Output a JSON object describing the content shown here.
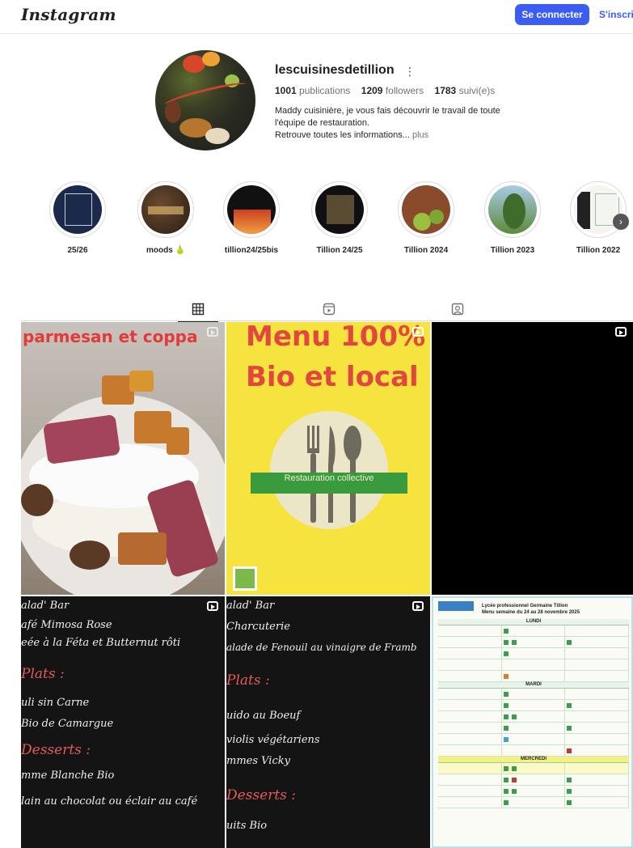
{
  "app": {
    "logo": "Instagram"
  },
  "nav": {
    "login_label": "Se connecter",
    "signup_label": "S'inscrire"
  },
  "profile": {
    "username": "lescuisinesdetillion",
    "more": "⋮",
    "stats": {
      "posts_num": "1001",
      "posts_label": "publications",
      "followers_num": "1209",
      "followers_label": "followers",
      "following_num": "1783",
      "following_label": "suivi(e)s"
    },
    "bio_line1": "Maddy cuisinière, je vous fais découvrir le travail de toute",
    "bio_line2": "l'équipe de restauration.",
    "bio_line3": "Retrouve toutes les informations...",
    "bio_more": "plus"
  },
  "highlights": [
    {
      "label": "25/26"
    },
    {
      "label": "moods 🍐"
    },
    {
      "label": "tillion24/25bis"
    },
    {
      "label": "Tillion 24/25"
    },
    {
      "label": "Tillion 2024"
    },
    {
      "label": "Tillion 2023"
    },
    {
      "label": "Tillion 2022"
    }
  ],
  "tabs": [
    "grid-icon",
    "reels-icon",
    "tagged-icon"
  ],
  "posts": {
    "p1_title": "parmesan et coppa",
    "p2_line1": "Menu 100%",
    "p2_line2": "Bio et local",
    "p2_banner": "Restauration collective",
    "p4_lines": [
      "alad' Bar",
      "afé Mimosa Rose",
      "eée à la Féta et Butternut rôti",
      "Plats :",
      "uli sin Carne",
      "Bio de Camargue",
      "Desserts :",
      "mme Blanche Bio",
      "lain au chocolat ou éclair au café"
    ],
    "p5_lines": [
      "alad' Bar",
      "Charcuterie",
      "alade de Fenouil au vinaigre de Framb",
      "Plats :",
      "uido au Boeuf",
      "violis végétariens",
      "mmes Vicky",
      "Desserts :",
      "uits Bio"
    ],
    "p6_header_1": "Lycée professionnel Germaine Tillion",
    "p6_header_2": "Menu semaine du 24 au 28 novembre 2025",
    "p6_day1": "LUNDI",
    "p6_day2": "MARDI",
    "p6_day3": "MERCREDI"
  }
}
